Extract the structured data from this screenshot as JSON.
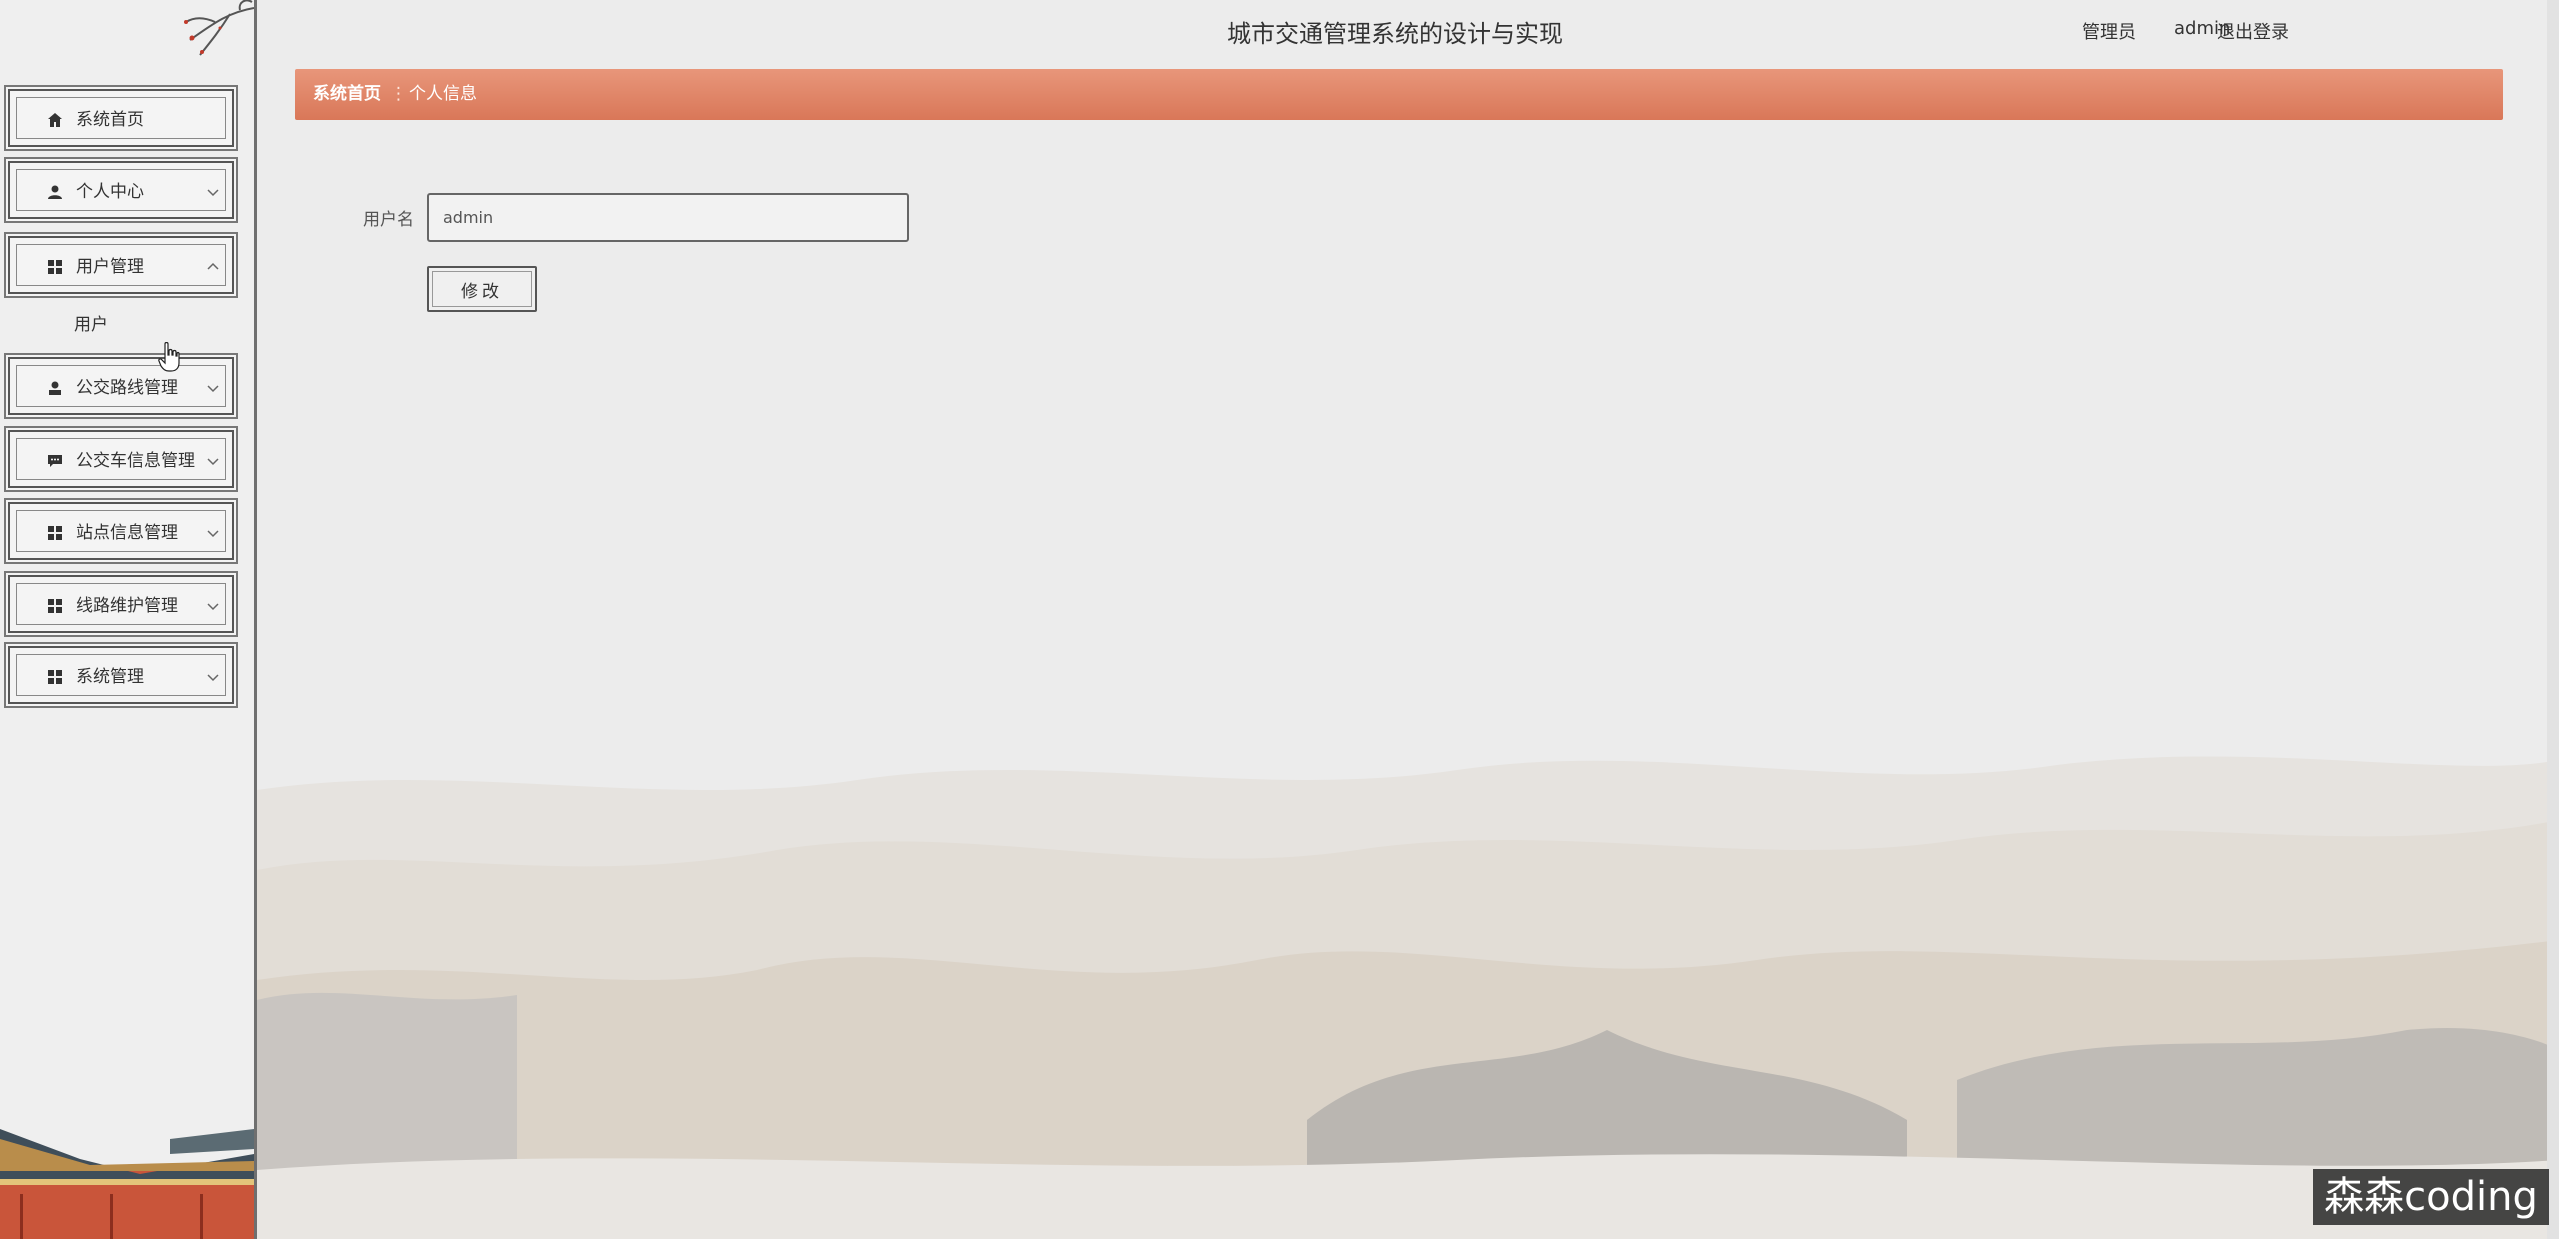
{
  "header": {
    "title": "城市交通管理系统的设计与实现",
    "role": "管理员",
    "username": "admin",
    "logout_label": "退出登录"
  },
  "sidebar": {
    "items": [
      {
        "label": "系统首页",
        "icon": "home-icon"
      },
      {
        "label": "个人中心",
        "icon": "person-icon",
        "expandable": true
      },
      {
        "label": "用户管理",
        "icon": "grid-icon",
        "expandable": true,
        "expanded": true
      },
      {
        "label": "公交路线管理",
        "icon": "user-icon",
        "expandable": true
      },
      {
        "label": "公交车信息管理",
        "icon": "chat-icon",
        "expandable": true
      },
      {
        "label": "站点信息管理",
        "icon": "grid-icon",
        "expandable": true
      },
      {
        "label": "线路维护管理",
        "icon": "grid-icon",
        "expandable": true
      },
      {
        "label": "系统管理",
        "icon": "grid-icon",
        "expandable": true
      }
    ],
    "submenu": {
      "label": "用户"
    }
  },
  "breadcrumb": {
    "home": "系统首页",
    "separator": "⋮",
    "current": "个人信息"
  },
  "form": {
    "username_label": "用户名",
    "username_value": "admin",
    "submit_label": "修改"
  },
  "watermark": "森森coding",
  "colors": {
    "accent": "#dc7c5e",
    "background": "#ececec",
    "sidebar_border": "#6f6f6f"
  }
}
